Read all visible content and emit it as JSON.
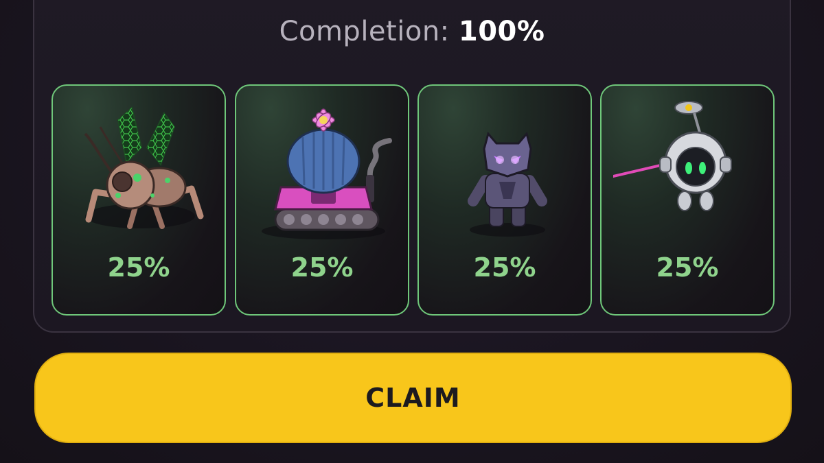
{
  "header": {
    "completion_label": "Completion:",
    "completion_value": "100%"
  },
  "cards": [
    {
      "character": "robotic-insect-icon",
      "percent": "25%"
    },
    {
      "character": "cactus-tank-icon",
      "percent": "25%"
    },
    {
      "character": "panther-robot-icon",
      "percent": "25%"
    },
    {
      "character": "sphere-drone-icon",
      "percent": "25%"
    }
  ],
  "claim_button": {
    "label": "CLAIM"
  },
  "colors": {
    "accent_green": "#8fd38c",
    "card_border": "#6fc77a",
    "claim_yellow": "#f8c61b",
    "background": "#1a1520"
  }
}
